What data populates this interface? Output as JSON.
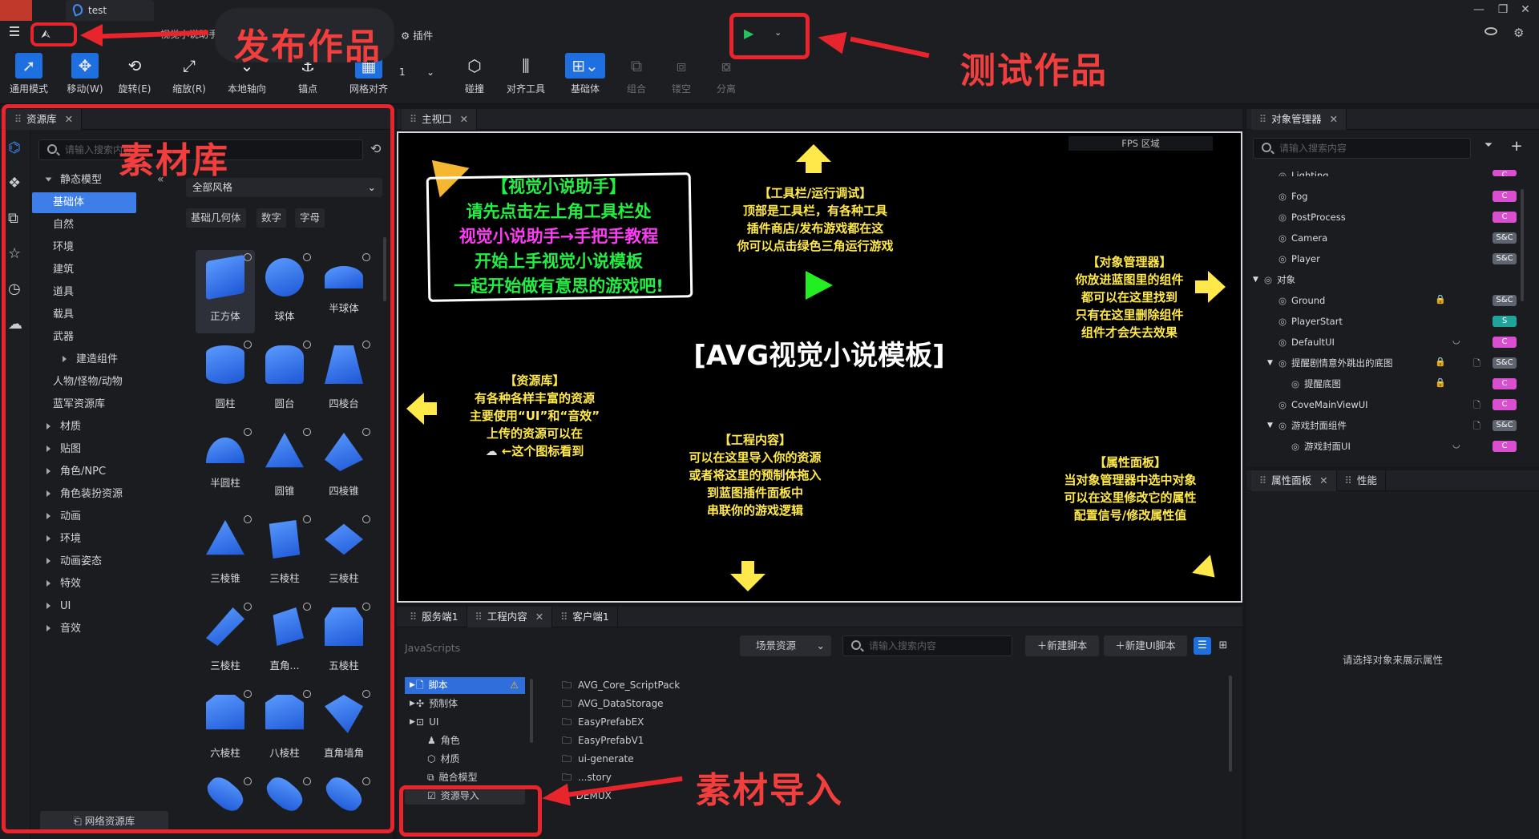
{
  "window": {
    "tab_title": "test",
    "minimize": "—",
    "restore": "❐",
    "close": "✕"
  },
  "menubar": {
    "publish_label": "视觉小说助手",
    "plugins": "插件"
  },
  "toolbar": {
    "tools": [
      {
        "label": "通用模式",
        "icon": "cursor-icon"
      },
      {
        "label": "移动(W)",
        "icon": "move-icon"
      },
      {
        "label": "旋转(E)",
        "icon": "rotate-icon"
      },
      {
        "label": "缩放(R)",
        "icon": "scale-icon"
      },
      {
        "label": "本地轴向",
        "icon": "axis-icon"
      },
      {
        "label": "锚点",
        "icon": "anchor-icon"
      },
      {
        "label": "网格对齐",
        "icon": "grid-snap-icon"
      },
      {
        "label": "碰撞",
        "icon": "collision-icon"
      },
      {
        "label": "对齐工具",
        "icon": "align-icon"
      },
      {
        "label": "基础体",
        "icon": "primitive-icon"
      },
      {
        "label": "组合",
        "icon": "group-icon"
      },
      {
        "label": "镂空",
        "icon": "hollow-icon"
      },
      {
        "label": "分离",
        "icon": "split-icon"
      }
    ],
    "grid_value": "1"
  },
  "annotations": {
    "publish": "发布作品",
    "test": "测试作品",
    "library": "素材库",
    "import": "素材导入"
  },
  "assets_panel": {
    "title": "资源库",
    "search_placeholder": "请输入搜索内容",
    "style_select": "全部风格",
    "filters": [
      "基础几何体",
      "数字",
      "字母"
    ],
    "categories": [
      {
        "label": "静态模型",
        "expanded": true
      },
      {
        "label": "基础体",
        "selected": true
      },
      {
        "label": "自然"
      },
      {
        "label": "环境"
      },
      {
        "label": "建筑"
      },
      {
        "label": "道具"
      },
      {
        "label": "载具"
      },
      {
        "label": "武器"
      },
      {
        "label": "建造组件"
      },
      {
        "label": "人物/怪物/动物"
      },
      {
        "label": "蓝军资源库"
      },
      {
        "label": "材质"
      },
      {
        "label": "贴图"
      },
      {
        "label": "角色/NPC"
      },
      {
        "label": "角色装扮资源"
      },
      {
        "label": "动画"
      },
      {
        "label": "环境"
      },
      {
        "label": "动画姿态"
      },
      {
        "label": "特效"
      },
      {
        "label": "UI"
      },
      {
        "label": "音效"
      }
    ],
    "network_button": "网络资源库",
    "assets": [
      "正方体",
      "球体",
      "半球体",
      "圆柱",
      "圆台",
      "四棱台",
      "半圆柱",
      "圆锥",
      "四棱锥",
      "三棱锥",
      "三棱柱",
      "三棱柱",
      "三棱柱",
      "直角...",
      "五棱柱",
      "六棱柱",
      "八棱柱",
      "直角墙角"
    ]
  },
  "viewport": {
    "tab": "主视口",
    "fps": "FPS 区域",
    "template_title": "[AVG视觉小说模板]",
    "helper_lines": [
      "【视觉小说助手】",
      "请先点击左上角工具栏处",
      "视觉小说助手→手把手教程",
      "开始上手视觉小说模板",
      "一起开始做有意思的游戏吧!"
    ],
    "toolbar_hint": [
      "【工具栏/运行调试】",
      "顶部是工具栏，有各种工具",
      "插件商店/发布游戏都在这",
      "你可以点击绿色三角运行游戏"
    ],
    "object_hint": [
      "【对象管理器】",
      "你放进蓝图里的组件",
      "都可以在这里找到",
      "只有在这里删除组件",
      "组件才会失去效果"
    ],
    "asset_hint": [
      "【资源库】",
      "有各种各样丰富的资源",
      "主要使用“UI”和“音效”",
      "上传的资源可以在",
      "←这个图标看到"
    ],
    "project_hint": [
      "【工程内容】",
      "可以在这里导入你的资源",
      "或者将这里的预制体拖入",
      "到蓝图插件面板中",
      "串联你的游戏逻辑"
    ],
    "property_hint": [
      "【属性面板】",
      "当对象管理器中选中对象",
      "可以在这里修改它的属性",
      "配置信号/修改属性值"
    ]
  },
  "bottom_panel": {
    "tabs": [
      "服务端1",
      "工程内容",
      "客户端1"
    ],
    "language": "JavaScripts",
    "scene_select": "场景资源",
    "search_placeholder": "请输入搜索内容",
    "new_script": "新建脚本",
    "new_ui_script": "新建UI脚本",
    "tree": [
      "脚本",
      "预制体",
      "UI",
      "角色",
      "材质",
      "融合模型",
      "资源导入"
    ],
    "files": [
      "AVG_Core_ScriptPack",
      "AVG_DataStorage",
      "EasyPrefabEX",
      "EasyPrefabV1",
      "ui-generate",
      "...story",
      "DEMUX"
    ]
  },
  "object_manager": {
    "title": "对象管理器",
    "search_placeholder": "请输入搜索内容",
    "rows": [
      {
        "label": "Lighting",
        "badge": "C"
      },
      {
        "label": "Fog",
        "badge": "C"
      },
      {
        "label": "PostProcess",
        "badge": "C"
      },
      {
        "label": "Camera",
        "badge": "S&C"
      },
      {
        "label": "Player",
        "badge": "S&C"
      },
      {
        "label": "对象",
        "badge": ""
      },
      {
        "label": "Ground",
        "badge": "S&C"
      },
      {
        "label": "PlayerStart",
        "badge": "S"
      },
      {
        "label": "DefaultUI",
        "badge": "C"
      },
      {
        "label": "提醒剧情意外跳出的底图",
        "badge": "S&C"
      },
      {
        "label": "提醒底图",
        "badge": "C"
      },
      {
        "label": "CoveMainViewUI",
        "badge": "C"
      },
      {
        "label": "游戏封面组件",
        "badge": "S&C"
      },
      {
        "label": "游戏封面UI",
        "badge": "C"
      }
    ]
  },
  "property_panel": {
    "tabs": [
      "属性面板",
      "性能"
    ],
    "empty": "请选择对象来展示属性"
  },
  "colors": {
    "accent": "#1e6fe0",
    "annotation": "#e8252c",
    "badge_c": "#d94fd0",
    "badge_sc": "#5f6570",
    "badge_s": "#1fa39b"
  }
}
